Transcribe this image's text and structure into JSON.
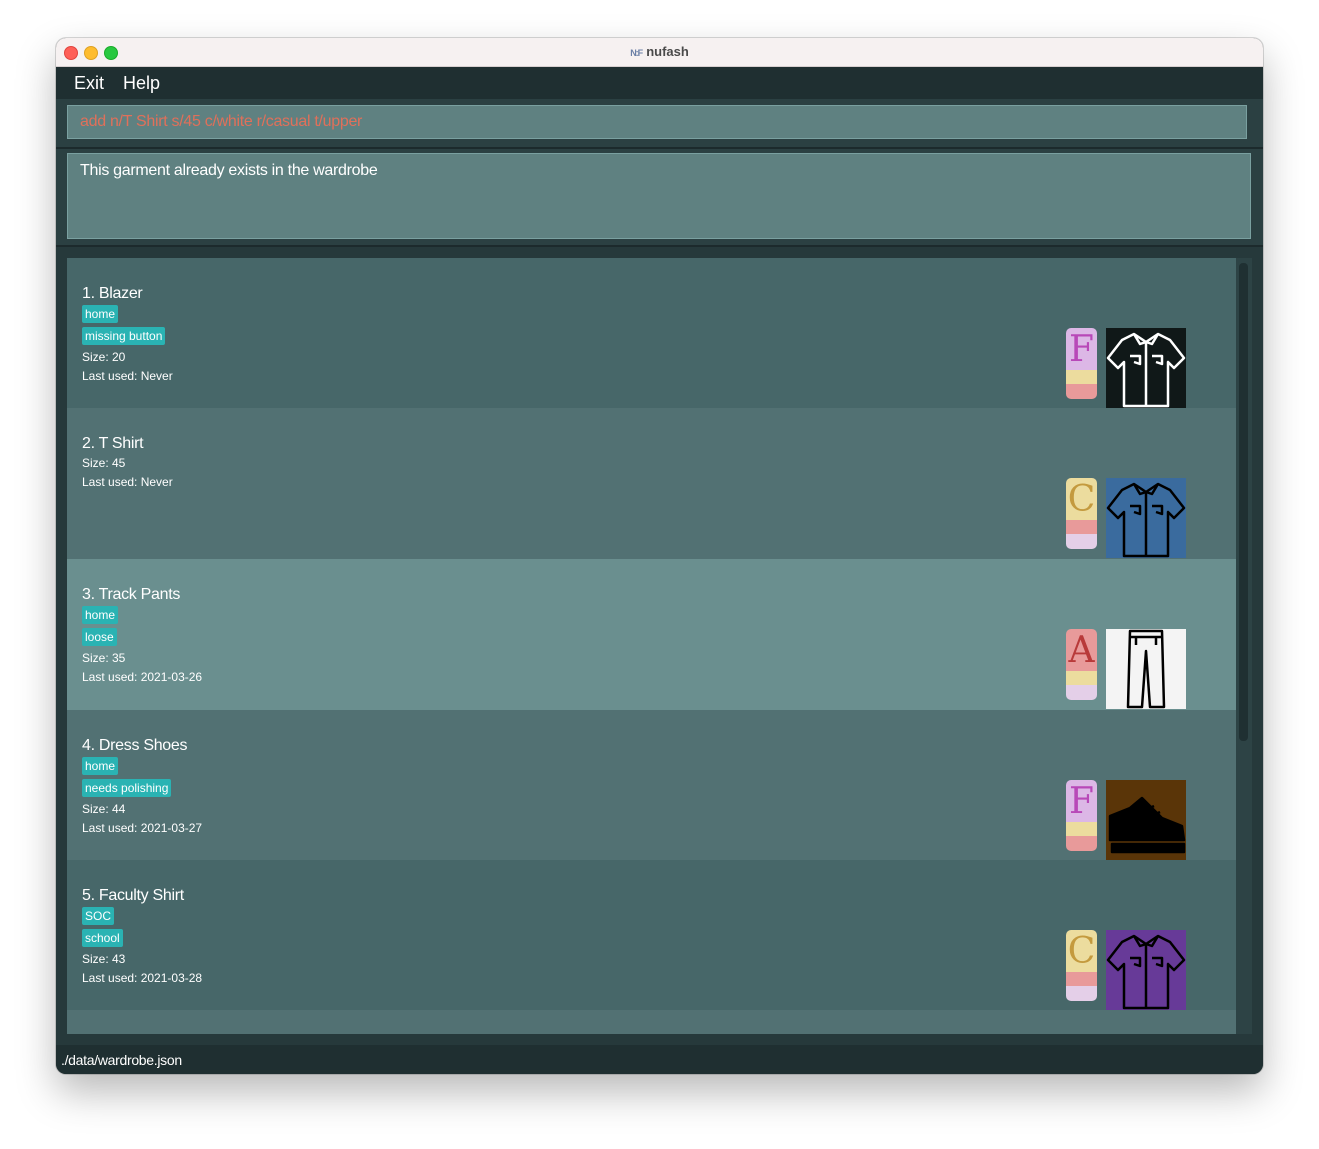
{
  "window": {
    "title": "nufash",
    "logo_text": "N:F"
  },
  "menu": {
    "exit_label": "Exit",
    "help_label": "Help"
  },
  "command": {
    "value": "add n/T Shirt s/45 c/white r/casual t/upper"
  },
  "result": {
    "message": "This garment already exists in the wardrobe"
  },
  "garments": [
    {
      "index": "1.",
      "name": "Blazer",
      "tags": [
        "home",
        "missing button"
      ],
      "size": "Size: 20",
      "last_used": "Last used: Never",
      "dress_code": "F",
      "dress_colors": [
        "#dcb7e6",
        "#ecdc9e",
        "#e89a9a"
      ],
      "letter_color": "#b848b8",
      "garment_icon": "shirt-icon",
      "garment_color": "#101818",
      "garment_stroke": "#ffffff"
    },
    {
      "index": "2.",
      "name": "T Shirt",
      "tags": [],
      "size": "Size: 45",
      "last_used": "Last used: Never",
      "dress_code": "C",
      "dress_colors": [
        "#ecdc9e",
        "#e89a9a",
        "#e4cfe8"
      ],
      "letter_color": "#c49a3e",
      "garment_icon": "shirt-icon",
      "garment_color": "#3a6b9e",
      "garment_stroke": "#000000"
    },
    {
      "index": "3.",
      "name": "Track Pants",
      "tags": [
        "home",
        "loose"
      ],
      "size": "Size: 35",
      "last_used": "Last used: 2021-03-26",
      "dress_code": "A",
      "dress_colors": [
        "#e89a9a",
        "#ecdc9e",
        "#e4cfe8"
      ],
      "letter_color": "#b83a3a",
      "garment_icon": "pants-icon",
      "garment_color": "#f4f4f4",
      "garment_stroke": "#000000"
    },
    {
      "index": "4.",
      "name": "Dress Shoes",
      "tags": [
        "home",
        "needs polishing"
      ],
      "size": "Size: 44",
      "last_used": "Last used: 2021-03-27",
      "dress_code": "F",
      "dress_colors": [
        "#dcb7e6",
        "#ecdc9e",
        "#e89a9a"
      ],
      "letter_color": "#b848b8",
      "garment_icon": "shoe-icon",
      "garment_color": "#5a3508",
      "garment_stroke": "#000000"
    },
    {
      "index": "5.",
      "name": "Faculty Shirt",
      "tags": [
        "SOC",
        "school"
      ],
      "size": "Size: 43",
      "last_used": "Last used: 2021-03-28",
      "dress_code": "C",
      "dress_colors": [
        "#ecdc9e",
        "#e89a9a",
        "#e4cfe8"
      ],
      "letter_color": "#c49a3e",
      "garment_icon": "shirt-icon",
      "garment_color": "#673a98",
      "garment_stroke": "#000000"
    }
  ],
  "status": {
    "file_path": "./data/wardrobe.json"
  }
}
